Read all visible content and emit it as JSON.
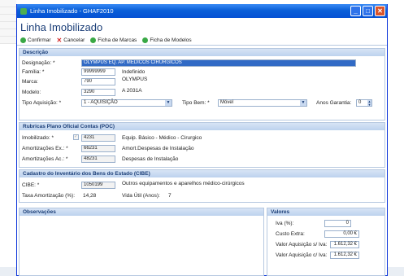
{
  "window": {
    "title": "Linha Imobilizado - GHAF2010"
  },
  "heading": "Linha Imobilizado",
  "toolbar": {
    "confirm": "Confirmar",
    "cancel": "Cancelar",
    "brand_sheet": "Ficha de Marcas",
    "model_sheet": "Ficha de Modelos"
  },
  "descricao": {
    "header": "Descrição",
    "designacao_label": "Designação: *",
    "designacao_value": "OLYMPUS EQ. AP. MÉDICOS CIRURGICOS",
    "familia_label": "Família: *",
    "familia_code": "99999999",
    "familia_desc": "Indefinido",
    "marca_label": "Marca:",
    "marca_code": "790",
    "marca_desc": "OLYMPUS",
    "modelo_label": "Modelo:",
    "modelo_code": "3290",
    "modelo_desc": "A 2031A",
    "tipo_aquisicao_label": "Tipo Aquisição: *",
    "tipo_aquisicao_value": "1 - AQUISIÇÃO",
    "tipo_bem_label": "Tipo Bem: *",
    "tipo_bem_value": "Móvel",
    "anos_garantia_label": "Anos Garantia:",
    "anos_garantia_value": "0"
  },
  "poc": {
    "header": "Rubricas Plano Oficial Contas (POC)",
    "imobilizado_label": "Imobilizado: *",
    "imobilizado_code": "4231",
    "imobilizado_desc": "Equip. Básico - Médico - Cirurgico",
    "amort_ex_label": "Amortizações Ex.: *",
    "amort_ex_code": "66231",
    "amort_ex_desc": "Amort.Despesas de Instalação",
    "amort_ac_label": "Amortizações Ac.: *",
    "amort_ac_code": "48231",
    "amort_ac_desc": "Despesas de Instalação"
  },
  "cibe": {
    "header": "Cadastro do Inventário dos Bens do Estado (CIBE)",
    "cibe_label": "CIBE: *",
    "cibe_code": "1050199",
    "cibe_desc": "Outros equipamentos e aparelhos médico-cirúrgicos",
    "taxa_label": "Taxa Amortização (%):",
    "taxa_value": "14,28",
    "vida_label": "Vida Útil (Anos):",
    "vida_value": "7"
  },
  "observacoes": {
    "header": "Observações"
  },
  "valores": {
    "header": "Valores",
    "iva_label": "Iva (%):",
    "iva_value": "0",
    "custo_label": "Custo Extra:",
    "custo_value": "0,00 €",
    "valor_s_iva_label": "Valor Aquisição s/ Iva:",
    "valor_s_iva_value": "1.612,32 €",
    "valor_c_iva_label": "Valor Aquisição c/ Iva:",
    "valor_c_iva_value": "1.612,32 €"
  }
}
